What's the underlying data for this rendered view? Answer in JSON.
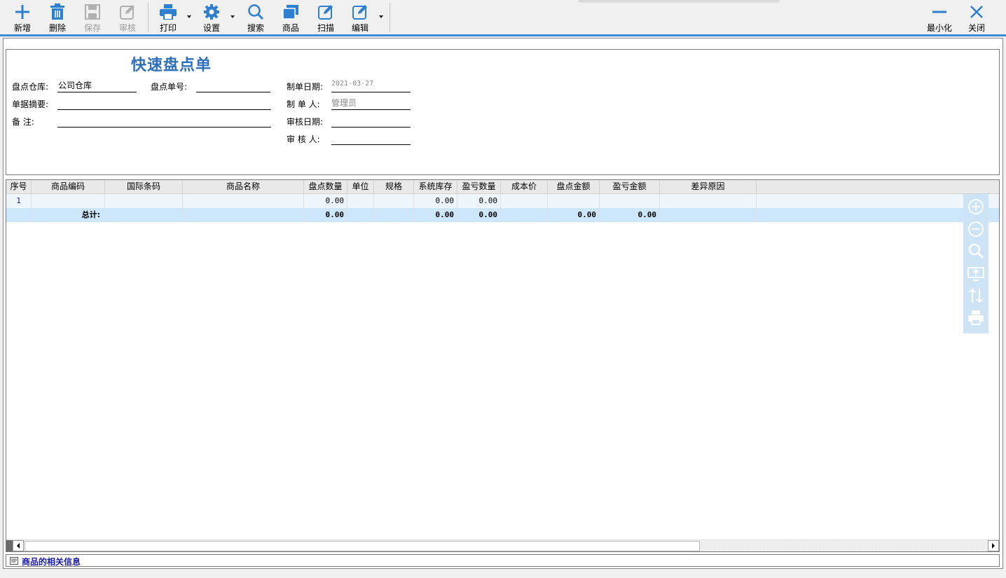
{
  "toolbar": {
    "new": "新增",
    "delete": "删除",
    "save": "保存",
    "review": "审核",
    "print": "打印",
    "settings": "设置",
    "search": "搜索",
    "product": "商品",
    "scan": "扫描",
    "edit": "编辑",
    "minimize": "最小化",
    "close": "关闭"
  },
  "colors": {
    "accent": "#3e8ad6",
    "icon": "#2e7fd0",
    "title": "#2e6fb9",
    "header_bg": "#e9e9e9",
    "row1_bg": "#eef6fc",
    "total_bg": "#cce6fb"
  },
  "form": {
    "title": "快速盘点单",
    "warehouse_label": "盘点仓库:",
    "warehouse_value": "公司仓库",
    "number_label": "盘点单号:",
    "number_value": "",
    "summary_label": "单据摘要:",
    "summary_value": "",
    "remark_label": "备      注:",
    "remark_value": "",
    "date_label": "制单日期:",
    "date_value": "2021-03-27",
    "maker_label": "制 单 人:",
    "maker_value": "管理员",
    "review_date_label": "审核日期:",
    "review_date_value": "",
    "reviewer_label": "审 核 人:",
    "reviewer_value": ""
  },
  "grid": {
    "headers": [
      "序号",
      "商品编码",
      "国际条码",
      "商品名称",
      "盘点数量",
      "单位",
      "规格",
      "系统库存",
      "盈亏数量",
      "成本价",
      "盘点金额",
      "盈亏金额",
      "差异原因"
    ],
    "row1": {
      "seq": "1",
      "count_qty": "0.00",
      "sys_stock": "0.00",
      "diff_qty": "0.00"
    },
    "total": {
      "label": "总计:",
      "count_qty": "0.00",
      "sys_stock": "0.00",
      "diff_qty": "0.00",
      "count_amount": "0.00",
      "diff_amount": "0.00"
    }
  },
  "side_tools": [
    "zoom-in-icon",
    "zoom-out-icon",
    "search-icon",
    "export-icon",
    "sort-icon",
    "print-icon"
  ],
  "info_bar": {
    "label": "商品的相关信息"
  }
}
